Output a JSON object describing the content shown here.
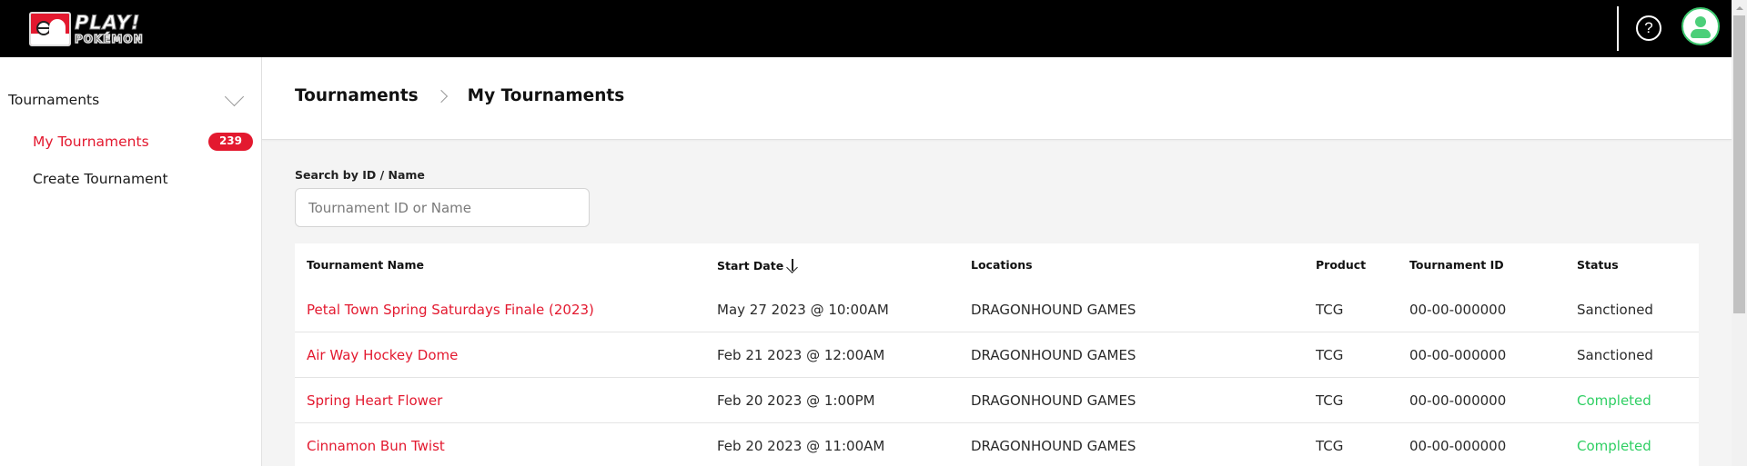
{
  "header": {
    "logo": {
      "line1": "PLAY!",
      "line2": "POKÉMON"
    },
    "help_icon_label": "?",
    "icons": {
      "help": "help-circle-icon",
      "avatar": "user-avatar-icon"
    }
  },
  "sidebar": {
    "section_label": "Tournaments",
    "section_icon": "chevron-down-icon",
    "items": [
      {
        "label": "My Tournaments",
        "badge": "239",
        "active": true
      },
      {
        "label": "Create Tournament"
      }
    ]
  },
  "breadcrumb": {
    "items": [
      "Tournaments",
      "My Tournaments"
    ],
    "separator_icon": "chevron-right-icon"
  },
  "search": {
    "label": "Search by ID / Name",
    "placeholder": "Tournament ID or Name",
    "value": ""
  },
  "table": {
    "columns": [
      "Tournament Name",
      "Start Date",
      "Locations",
      "Product",
      "Tournament ID",
      "Status"
    ],
    "sort": {
      "column": "Start Date",
      "direction": "descending",
      "icon": "arrow-down-icon"
    },
    "rows": [
      {
        "name": "Petal Town Spring Saturdays Finale (2023)",
        "start_date": "May 27 2023 @ 10:00AM",
        "location": "DRAGONHOUND GAMES",
        "product": "TCG",
        "id": "00-00-000000",
        "status": "Sanctioned"
      },
      {
        "name": "Air Way Hockey Dome",
        "start_date": "Feb 21 2023 @ 12:00AM",
        "location": "DRAGONHOUND GAMES",
        "product": "TCG",
        "id": "00-00-000000",
        "status": "Sanctioned"
      },
      {
        "name": "Spring Heart Flower",
        "start_date": "Feb 20 2023 @ 1:00PM",
        "location": "DRAGONHOUND GAMES",
        "product": "TCG",
        "id": "00-00-000000",
        "status": "Completed"
      },
      {
        "name": "Cinnamon Bun Twist",
        "start_date": "Feb 20 2023 @ 11:00AM",
        "location": "DRAGONHOUND GAMES",
        "product": "TCG",
        "id": "00-00-000000",
        "status": "Completed"
      }
    ]
  },
  "colors": {
    "brand_red": "#e3192f",
    "completed_green": "#2fcf63",
    "avatar_green": "#4ccf79",
    "header_bg": "#000000"
  }
}
